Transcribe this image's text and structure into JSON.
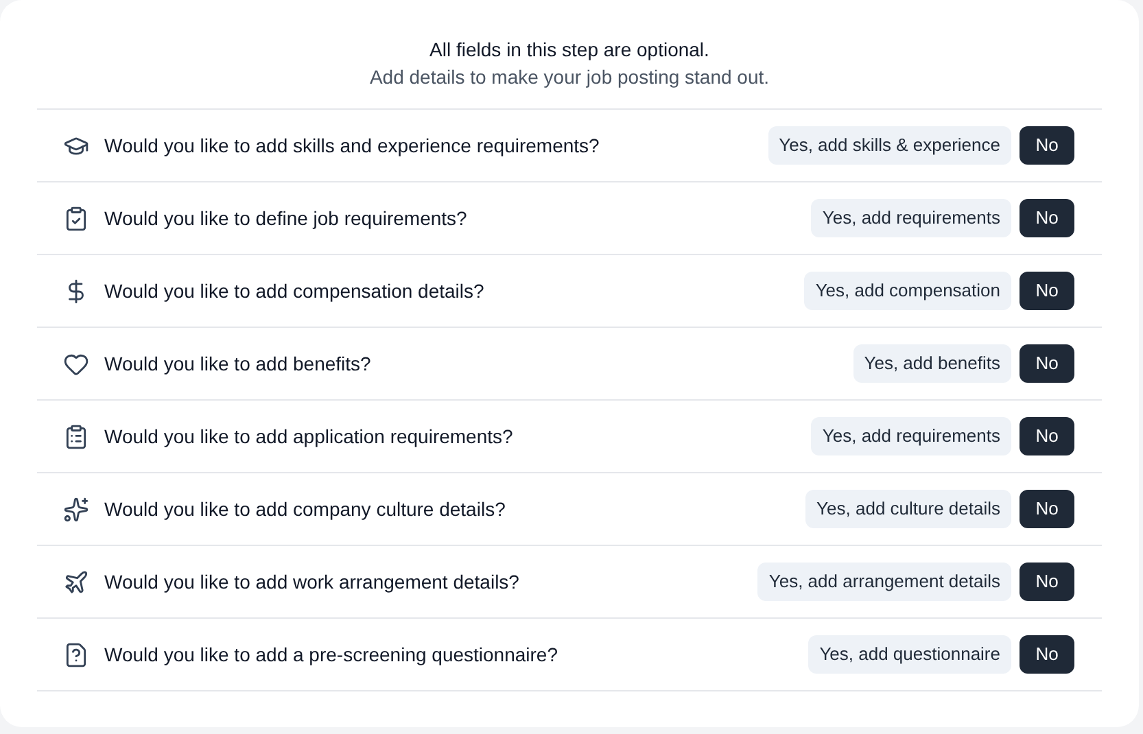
{
  "header": {
    "title": "All fields in this step are optional.",
    "subtitle": "Add details to make your job posting stand out."
  },
  "questions": [
    {
      "kind": "graduation",
      "text": "Would you like to add skills and experience requirements?",
      "yes": {
        "label": "Yes, add skills & experience",
        "selected": false
      },
      "no": {
        "label": "No",
        "selected": true
      }
    },
    {
      "kind": "clipboard-check",
      "text": "Would you like to define job requirements?",
      "yes": {
        "label": "Yes, add requirements",
        "selected": false
      },
      "no": {
        "label": "No",
        "selected": true
      }
    },
    {
      "kind": "dollar",
      "text": "Would you like to add compensation details?",
      "yes": {
        "label": "Yes, add compensation",
        "selected": false
      },
      "no": {
        "label": "No",
        "selected": true
      }
    },
    {
      "kind": "heart",
      "text": "Would you like to add benefits?",
      "yes": {
        "label": "Yes, add benefits",
        "selected": false
      },
      "no": {
        "label": "No",
        "selected": true
      }
    },
    {
      "kind": "clipboard-list",
      "text": "Would you like to add application requirements?",
      "yes": {
        "label": "Yes, add requirements",
        "selected": false
      },
      "no": {
        "label": "No",
        "selected": true
      }
    },
    {
      "kind": "sparkles",
      "text": "Would you like to add company culture details?",
      "yes": {
        "label": "Yes, add culture details",
        "selected": false
      },
      "no": {
        "label": "No",
        "selected": true
      }
    },
    {
      "kind": "plane",
      "text": "Would you like to add work arrangement details?",
      "yes": {
        "label": "Yes, add arrangement details",
        "selected": false
      },
      "no": {
        "label": "No",
        "selected": true
      }
    },
    {
      "kind": "question",
      "text": "Would you like to add a pre-screening questionnaire?",
      "yes": {
        "label": "Yes, add questionnaire",
        "selected": false
      },
      "no": {
        "label": "No",
        "selected": true
      }
    }
  ]
}
